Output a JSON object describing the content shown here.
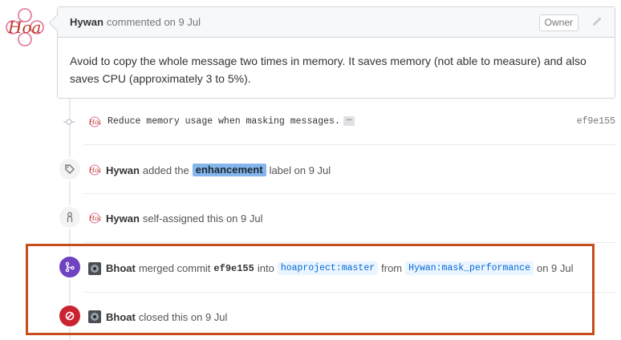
{
  "comment": {
    "author": "Hywan",
    "meta": "commented on 9 Jul",
    "badge": "Owner",
    "body": "Avoid to copy the whole message two times in memory. It saves memory (not able to measure) and also saves CPU (approximately 3 to 5%)."
  },
  "commit": {
    "message": "Reduce memory usage when masking messages.",
    "ellipsis": "…",
    "sha": "ef9e155"
  },
  "label_event": {
    "actor": "Hywan",
    "action": "added the",
    "label": "enhancement",
    "suffix": "label on 9 Jul",
    "label_color": "#84b6eb"
  },
  "assign_event": {
    "actor": "Hywan",
    "text": "self-assigned this on 9 Jul"
  },
  "merge_event": {
    "actor": "Bhoat",
    "action": "merged commit",
    "sha": "ef9e155",
    "into": "into",
    "base": "hoaproject:master",
    "from": "from",
    "head": "Hywan:mask_performance",
    "date": "on 9 Jul",
    "color": "#6f42c1"
  },
  "close_event": {
    "actor": "Bhoat",
    "text": "closed this on 9 Jul",
    "color": "#cb2431"
  },
  "highlight_color": "#c84d1c"
}
